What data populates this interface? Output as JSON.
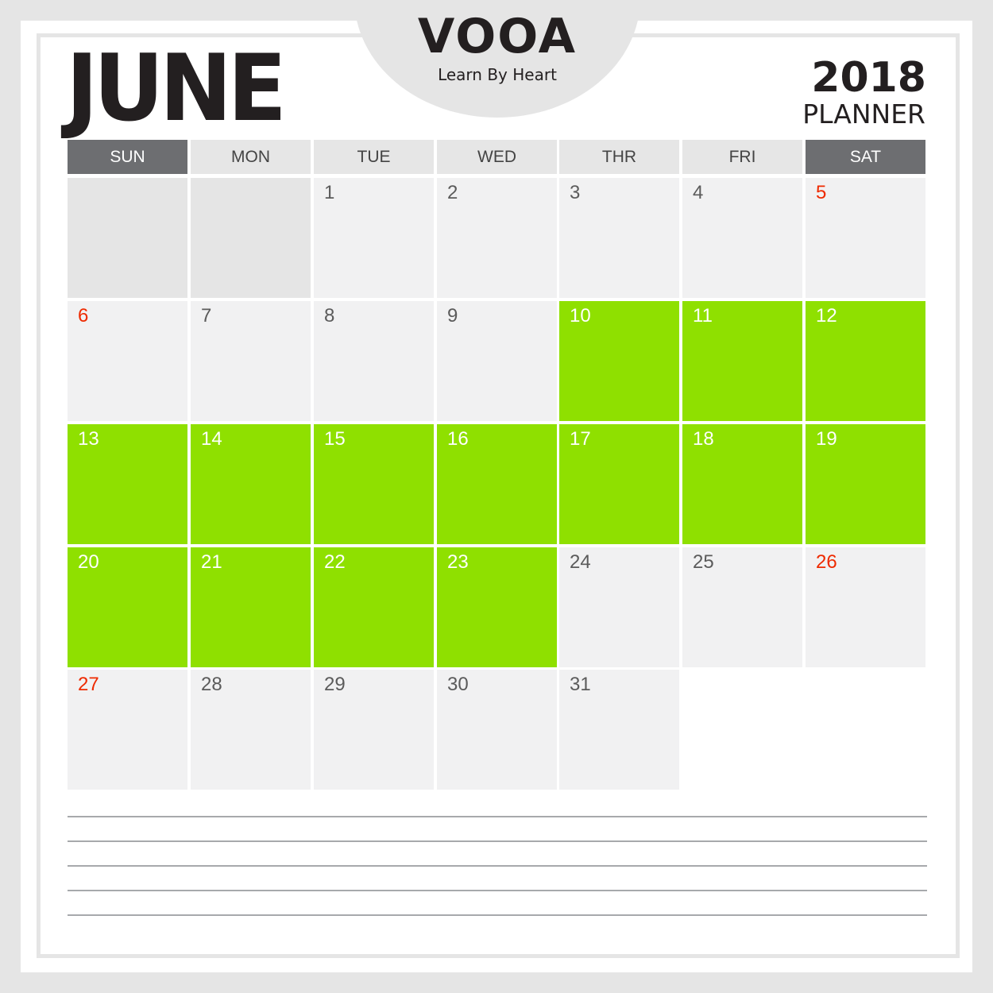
{
  "logo": {
    "word": "VOOA",
    "tagline": "Learn By Heart"
  },
  "header": {
    "month": "JUNE",
    "year": "2018",
    "subtitle": "PLANNER"
  },
  "weekdays": [
    "SUN",
    "MON",
    "TUE",
    "WED",
    "THR",
    "FRI",
    "SAT"
  ],
  "colors": {
    "highlight": "#8fe000",
    "weekend_number": "#ee2a00",
    "weekend_header": "#6d6e71",
    "cell": "#f1f1f2"
  },
  "weeks": [
    [
      {
        "day": "",
        "state": "empty"
      },
      {
        "day": "",
        "state": "empty"
      },
      {
        "day": "1",
        "state": "normal"
      },
      {
        "day": "2",
        "state": "normal"
      },
      {
        "day": "3",
        "state": "normal"
      },
      {
        "day": "4",
        "state": "normal"
      },
      {
        "day": "5",
        "state": "weekend"
      }
    ],
    [
      {
        "day": "6",
        "state": "weekend"
      },
      {
        "day": "7",
        "state": "normal"
      },
      {
        "day": "8",
        "state": "normal"
      },
      {
        "day": "9",
        "state": "normal"
      },
      {
        "day": "10",
        "state": "highlight"
      },
      {
        "day": "11",
        "state": "highlight"
      },
      {
        "day": "12",
        "state": "highlight"
      }
    ],
    [
      {
        "day": "13",
        "state": "highlight"
      },
      {
        "day": "14",
        "state": "highlight"
      },
      {
        "day": "15",
        "state": "highlight"
      },
      {
        "day": "16",
        "state": "highlight"
      },
      {
        "day": "17",
        "state": "highlight"
      },
      {
        "day": "18",
        "state": "highlight"
      },
      {
        "day": "19",
        "state": "highlight"
      }
    ],
    [
      {
        "day": "20",
        "state": "highlight"
      },
      {
        "day": "21",
        "state": "highlight"
      },
      {
        "day": "22",
        "state": "highlight"
      },
      {
        "day": "23",
        "state": "highlight"
      },
      {
        "day": "24",
        "state": "normal"
      },
      {
        "day": "25",
        "state": "normal"
      },
      {
        "day": "26",
        "state": "weekend"
      }
    ],
    [
      {
        "day": "27",
        "state": "weekend"
      },
      {
        "day": "28",
        "state": "normal"
      },
      {
        "day": "29",
        "state": "normal"
      },
      {
        "day": "30",
        "state": "normal"
      },
      {
        "day": "31",
        "state": "normal"
      },
      {
        "day": "",
        "state": "blank"
      },
      {
        "day": "",
        "state": "blank"
      }
    ]
  ],
  "notes": {
    "line_count": 5
  }
}
